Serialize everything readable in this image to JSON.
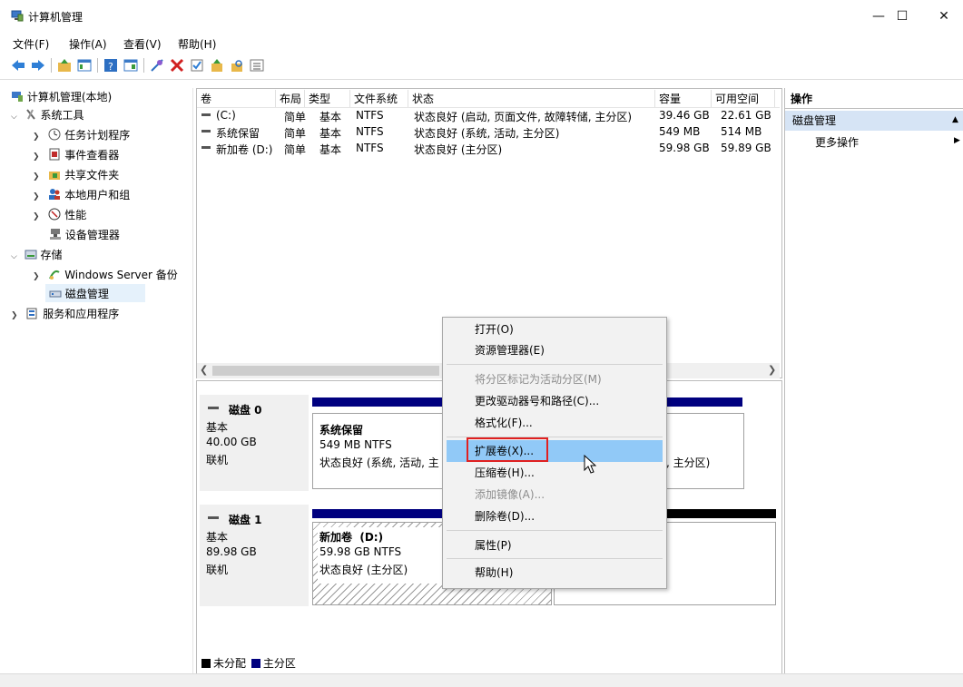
{
  "window": {
    "title": "计算机管理",
    "minimize": "—",
    "maximize": "☐",
    "close": "✕"
  },
  "menu": [
    "文件(F)",
    "操作(A)",
    "查看(V)",
    "帮助(H)"
  ],
  "tree": {
    "root": "计算机管理(本地)",
    "system_tools": "系统工具",
    "task_scheduler": "任务计划程序",
    "event_viewer": "事件查看器",
    "shared_folders": "共享文件夹",
    "local_users": "本地用户和组",
    "performance": "性能",
    "device_manager": "设备管理器",
    "storage": "存储",
    "windows_backup": "Windows Server 备份",
    "disk_management": "磁盘管理",
    "services_apps": "服务和应用程序"
  },
  "volumes": {
    "headers": [
      "卷",
      "布局",
      "类型",
      "文件系统",
      "状态",
      "容量",
      "可用空间"
    ],
    "rows": [
      [
        "(C:)",
        "简单",
        "基本",
        "NTFS",
        "状态良好 (启动, 页面文件, 故障转储, 主分区)",
        "39.46 GB",
        "22.61 GB"
      ],
      [
        "系统保留",
        "简单",
        "基本",
        "NTFS",
        "状态良好 (系统, 活动, 主分区)",
        "549 MB",
        "514 MB"
      ],
      [
        "新加卷 (D:)",
        "简单",
        "基本",
        "NTFS",
        "状态良好 (主分区)",
        "59.98 GB",
        "59.89 GB"
      ]
    ]
  },
  "disks": [
    {
      "name": "磁盘 0",
      "type": "基本",
      "size": "40.00 GB",
      "status": "联机",
      "part1_name": "系统保留",
      "part1_size": "549 MB NTFS",
      "part1_status": "状态良好 (系统, 活动, 主",
      "part2_status_tail": ", 主分区)"
    },
    {
      "name": "磁盘 1",
      "type": "基本",
      "size": "89.98 GB",
      "status": "联机",
      "part1_name": "新加卷  (D:)",
      "part1_size": "59.98 GB NTFS",
      "part1_status": "状态良好 (主分区)"
    }
  ],
  "legend": {
    "unallocated": "未分配",
    "primary": "主分区"
  },
  "actions": {
    "header": "操作",
    "group": "磁盘管理",
    "more": "更多操作"
  },
  "context_menu": {
    "open": "打开(O)",
    "explorer": "资源管理器(E)",
    "mark_active": "将分区标记为活动分区(M)",
    "change_letter": "更改驱动器号和路径(C)...",
    "format": "格式化(F)...",
    "extend": "扩展卷(X)...",
    "shrink": "压缩卷(H)...",
    "add_mirror": "添加镜像(A)...",
    "delete": "删除卷(D)...",
    "properties": "属性(P)",
    "help": "帮助(H)"
  },
  "colors": {
    "primary_partition": "#00007f",
    "unallocated": "#000000",
    "highlight": "#91c9f7",
    "callout_border": "#e02020"
  }
}
